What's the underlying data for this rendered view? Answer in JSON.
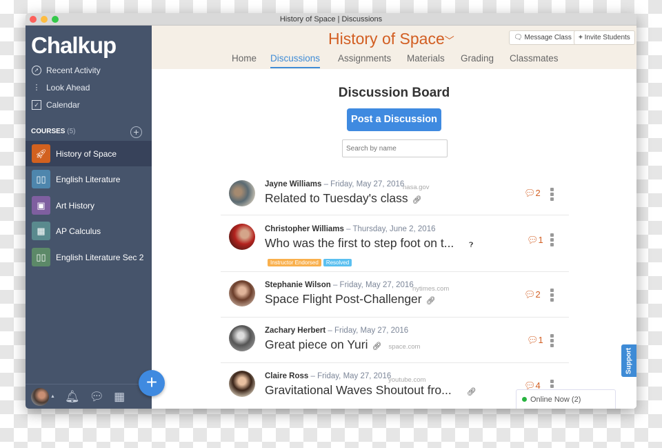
{
  "window": {
    "title": "History of Space | Discussions"
  },
  "sidebar": {
    "logo": "Chalkup",
    "nav": [
      {
        "label": "Recent Activity",
        "icon": "compass-icon"
      },
      {
        "label": "Look Ahead",
        "icon": "timeline-icon"
      },
      {
        "label": "Calendar",
        "icon": "calendar-icon"
      }
    ],
    "courses_label": "COURSES",
    "courses_count": "(5)",
    "courses": [
      {
        "label": "History of Space",
        "color": "#d2611f",
        "icon": "rocket-icon"
      },
      {
        "label": "English Literature",
        "color": "#4e86ad",
        "icon": "book-icon"
      },
      {
        "label": "Art History",
        "color": "#7f5fa0",
        "icon": "image-icon"
      },
      {
        "label": "AP Calculus",
        "color": "#5a8a8e",
        "icon": "calculator-icon"
      },
      {
        "label": "English Literature Sec 2",
        "color": "#5c8968",
        "icon": "book-icon"
      }
    ]
  },
  "header": {
    "course_title": "History of Space",
    "message_label": "Message Class",
    "invite_label": "Invite Students",
    "tabs": [
      "Home",
      "Discussions",
      "Assignments",
      "Materials",
      "Grading",
      "Classmates"
    ],
    "active_tab": "Discussions"
  },
  "board": {
    "title": "Discussion Board",
    "post_label": "Post a Discussion",
    "search_placeholder": "Search by name",
    "posts": [
      {
        "author": "Jayne Williams",
        "date": "– Friday, May 27, 2016",
        "domain": "nasa.gov",
        "title": "Related to Tuesday's class",
        "comments": "2"
      },
      {
        "author": "Christopher Williams",
        "date": "– Thursday, June 2, 2016",
        "domain": "",
        "title": "Who was the first to step foot on t...",
        "comments": "1",
        "tags": [
          "Instructor Endorsed",
          "Resolved"
        ]
      },
      {
        "author": "Stephanie Wilson",
        "date": "– Friday, May 27, 2016",
        "domain": "nytimes.com",
        "title": "Space Flight Post-Challenger",
        "comments": "2"
      },
      {
        "author": "Zachary Herbert",
        "date": "– Friday, May 27, 2016",
        "domain": "space.com",
        "title": "Great piece on Yuri",
        "comments": "1"
      },
      {
        "author": "Claire Ross",
        "date": "– Friday, May 27, 2016",
        "domain": "youtube.com",
        "title": "Gravitational Waves Shoutout fro...",
        "comments": "4"
      }
    ]
  },
  "support_label": "Support",
  "online_label": "Online Now (2)",
  "colors": {
    "accent": "#3e8bd6",
    "brand_orange": "#d25e22",
    "sidebar": "#46546b"
  }
}
